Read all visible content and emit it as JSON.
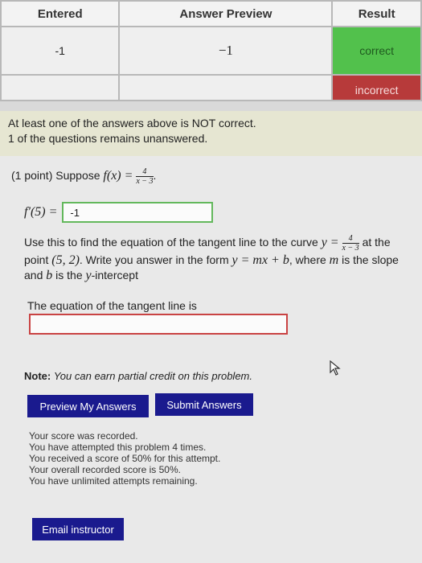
{
  "table": {
    "headers": [
      "Entered",
      "Answer Preview",
      "Result"
    ],
    "rows": [
      {
        "entered": "-1",
        "preview": "−1",
        "result": "correct"
      },
      {
        "entered": "",
        "preview": "",
        "result": "incorrect"
      }
    ],
    "colors": {
      "correct": "#52c14c",
      "incorrect": "#b73a3a"
    }
  },
  "messages": {
    "line1": "At least one of the answers above is NOT correct.",
    "line2": "1 of the questions remains unanswered."
  },
  "problem": {
    "points": "(1 point) Suppose",
    "f_lhs": "f(x) =",
    "frac_num": "4",
    "frac_den": "x − 3",
    "frac_end": ".",
    "deriv_label": "f′(5) =",
    "deriv_value": "-1",
    "text1": "Use this to find the equation of the tangent line to the curve",
    "y_eq": "y =",
    "text2": "at the",
    "text3": "point",
    "point": "(5, 2)",
    "text4": ". Write you answer in the form",
    "form": "y = mx + b",
    "text5": ", where",
    "m": "m",
    "text6": "is the slope",
    "text7": "and",
    "b": "b",
    "text8": "is the",
    "y": "y",
    "text9": "-intercept",
    "tangent_label": "The equation of the tangent line is",
    "tangent_value": "",
    "note_label": "Note:",
    "note_text": "You can earn partial credit on this problem."
  },
  "buttons": {
    "preview": "Preview My Answers",
    "submit": "Submit Answers",
    "email": "Email instructor",
    "color": "#1a1a8e"
  },
  "score": [
    "Your score was recorded.",
    "You have attempted this problem 4 times.",
    "You received a score of 50% for this attempt.",
    "Your overall recorded score is 50%.",
    "You have unlimited attempts remaining."
  ]
}
